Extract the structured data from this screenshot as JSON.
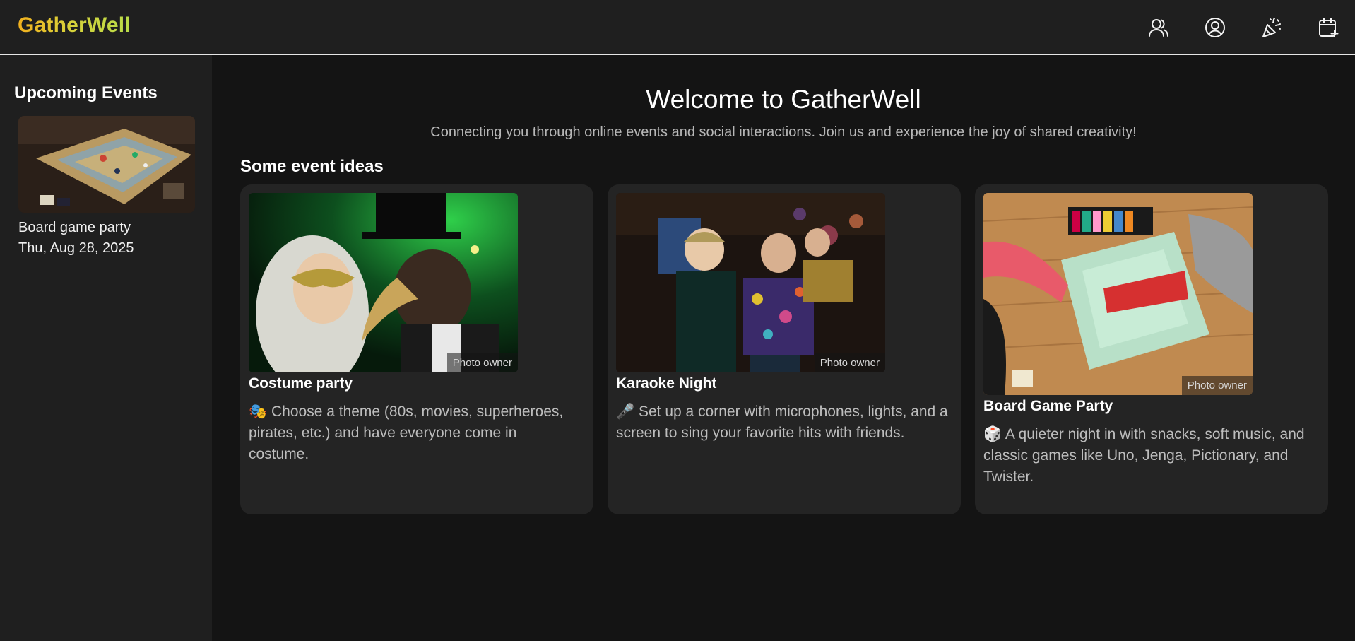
{
  "brand": {
    "name": "GatherWell"
  },
  "nav": [
    {
      "name": "friends-icon"
    },
    {
      "name": "profile-icon"
    },
    {
      "name": "party-popper-icon"
    },
    {
      "name": "calendar-add-icon"
    }
  ],
  "sidebar": {
    "heading": "Upcoming Events",
    "events": [
      {
        "title": "Board game party",
        "date": "Thu, Aug 28, 2025"
      }
    ]
  },
  "main": {
    "welcome": "Welcome to GatherWell",
    "tagline": "Connecting you through online events and social interactions. Join us and experience the joy of shared creativity!",
    "ideas_heading": "Some event ideas",
    "ideas": [
      {
        "title": "Costume party",
        "emoji": "🎭",
        "description": "Choose a theme (80s, movies, superheroes, pirates, etc.) and have everyone come in costume.",
        "credit": "Photo owner"
      },
      {
        "title": "Karaoke Night",
        "emoji": "🎤",
        "description": "Set up a corner with microphones, lights, and a screen to sing your favorite hits with friends.",
        "credit": "Photo owner"
      },
      {
        "title": "Board Game Party",
        "emoji": "🎲",
        "description": "A quieter night in with snacks, soft music, and classic games like Uno, Jenga, Pictionary, and Twister.",
        "credit": "Photo owner"
      }
    ]
  },
  "colors": {
    "brand_gradient_start": "#f2b01e",
    "brand_gradient_end": "#b8dc49",
    "background": "#141414",
    "panel": "#1f1f1f",
    "card": "#242424"
  }
}
